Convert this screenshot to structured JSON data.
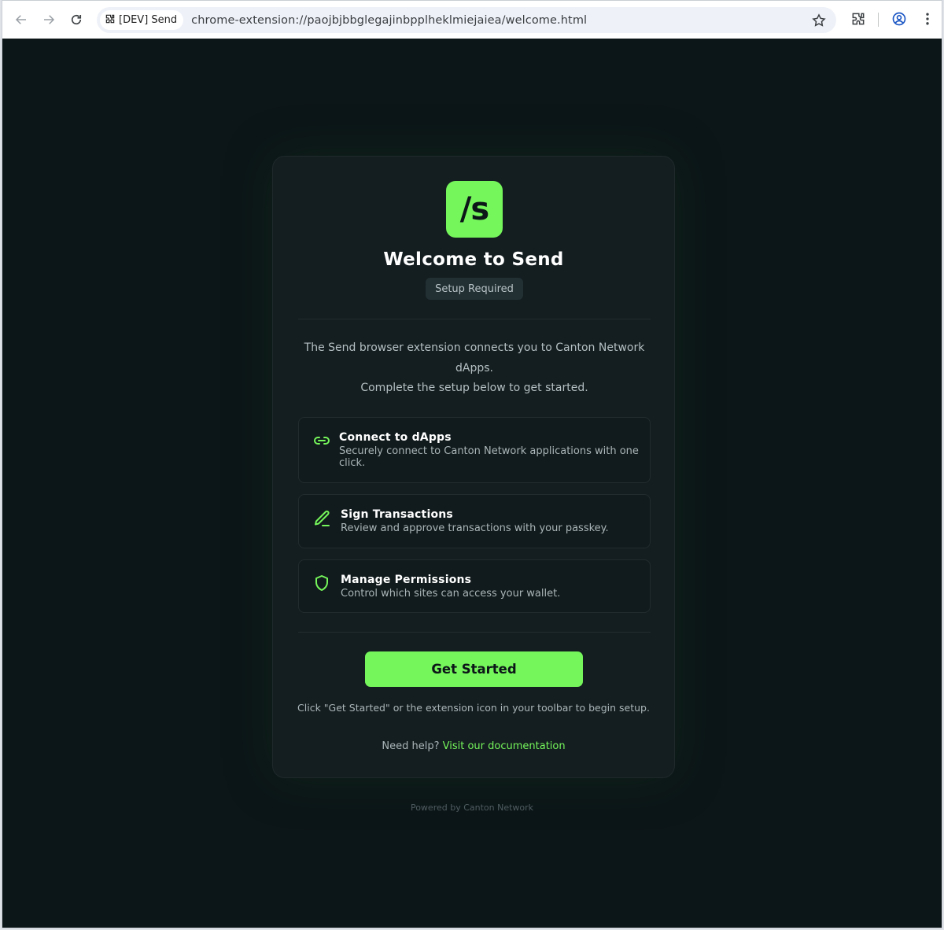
{
  "browser": {
    "site_chip_label": "[DEV] Send",
    "url": "chrome-extension://paojbjbbglegajinbpplheklmiejaiea/welcome.html",
    "icons": [
      "back-arrow-icon",
      "forward-arrow-icon",
      "reload-icon",
      "extension-puzzle-icon",
      "star-icon",
      "extensions-icon",
      "profile-icon",
      "more-vert-icon"
    ]
  },
  "card": {
    "logo_text": "/s",
    "title": "Welcome to Send",
    "badge": "Setup Required",
    "intro_line1": "The Send browser extension connects you to Canton Network dApps.",
    "intro_line2": "Complete the setup below to get started.",
    "features": [
      {
        "icon": "link-icon",
        "title": "Connect to dApps",
        "description": "Securely connect to Canton Network applications with one click."
      },
      {
        "icon": "pen-icon",
        "title": "Sign Transactions",
        "description": "Review and approve transactions with your passkey."
      },
      {
        "icon": "shield-icon",
        "title": "Manage Permissions",
        "description": "Control which sites can access your wallet."
      }
    ],
    "cta_label": "Get Started",
    "hint": "Click \"Get Started\" or the extension icon in your toolbar to begin setup.",
    "help_prefix": "Need help?",
    "help_link": "Visit our documentation"
  },
  "footer": "Powered by Canton Network",
  "colors": {
    "accent": "#75f65b",
    "background": "#0c1518",
    "card": "#141d20"
  }
}
